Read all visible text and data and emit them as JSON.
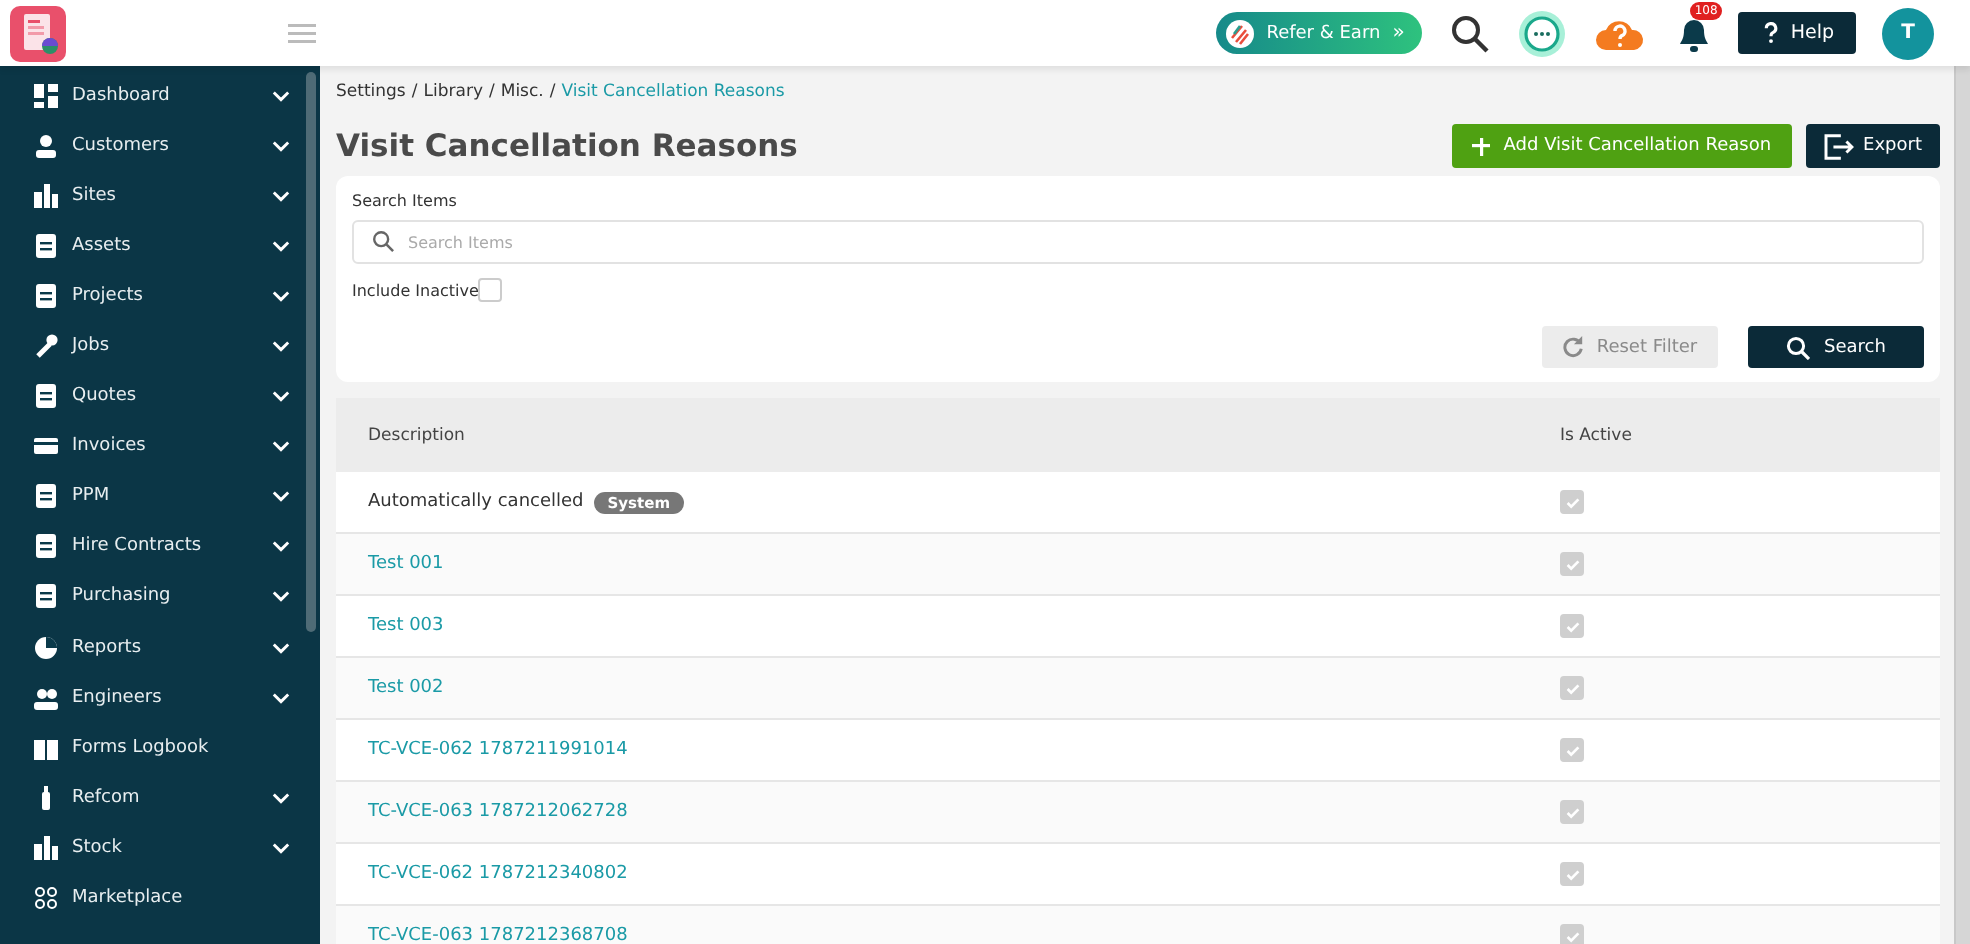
{
  "header": {
    "refer_button": "Refer & Earn",
    "refer_chevron": "»",
    "notifications_count": "108",
    "help_button": "Help",
    "avatar_initial": "T"
  },
  "sidebar": {
    "items": [
      {
        "label": "Dashboard",
        "expandable": true
      },
      {
        "label": "Customers",
        "expandable": true
      },
      {
        "label": "Sites",
        "expandable": true
      },
      {
        "label": "Assets",
        "expandable": true
      },
      {
        "label": "Projects",
        "expandable": true
      },
      {
        "label": "Jobs",
        "expandable": true
      },
      {
        "label": "Quotes",
        "expandable": true
      },
      {
        "label": "Invoices",
        "expandable": true
      },
      {
        "label": "PPM",
        "expandable": true
      },
      {
        "label": "Hire Contracts",
        "expandable": true
      },
      {
        "label": "Purchasing",
        "expandable": true
      },
      {
        "label": "Reports",
        "expandable": true
      },
      {
        "label": "Engineers",
        "expandable": true
      },
      {
        "label": "Forms Logbook",
        "expandable": false
      },
      {
        "label": "Refcom",
        "expandable": true
      },
      {
        "label": "Stock",
        "expandable": true
      },
      {
        "label": "Marketplace",
        "expandable": false
      }
    ]
  },
  "breadcrumb": {
    "separator": "/",
    "items": [
      {
        "label": "Settings",
        "current": false
      },
      {
        "label": "Library",
        "current": false
      },
      {
        "label": "Misc.",
        "current": false
      },
      {
        "label": "Visit Cancellation Reasons",
        "current": true
      }
    ]
  },
  "page_title": "Visit Cancellation Reasons",
  "actions": {
    "add_button": "Add Visit Cancellation Reason",
    "export_button": "Export"
  },
  "filters": {
    "search_label": "Search Items",
    "search_placeholder": "Search Items",
    "include_inactive_label": "Include Inactive",
    "include_inactive_checked": false,
    "reset_button": "Reset Filter",
    "reset_disabled": true,
    "search_button": "Search"
  },
  "table": {
    "columns": [
      "Description",
      "Is Active"
    ],
    "rows": [
      {
        "description": "Automatically cancelled",
        "kind": "plain",
        "badge": "System",
        "active": true
      },
      {
        "description": "Test 001",
        "kind": "link",
        "active": true
      },
      {
        "description": "Test 003",
        "kind": "link",
        "active": true
      },
      {
        "description": "Test 002",
        "kind": "link",
        "active": true
      },
      {
        "description": "TC-VCE-062 1787211991014",
        "kind": "link",
        "active": true
      },
      {
        "description": "TC-VCE-063 1787212062728",
        "kind": "link",
        "active": true
      },
      {
        "description": "TC-VCE-062 1787212340802",
        "kind": "link",
        "active": true
      },
      {
        "description": "TC-VCE-063 1787212368708",
        "kind": "link",
        "active": true
      }
    ]
  }
}
